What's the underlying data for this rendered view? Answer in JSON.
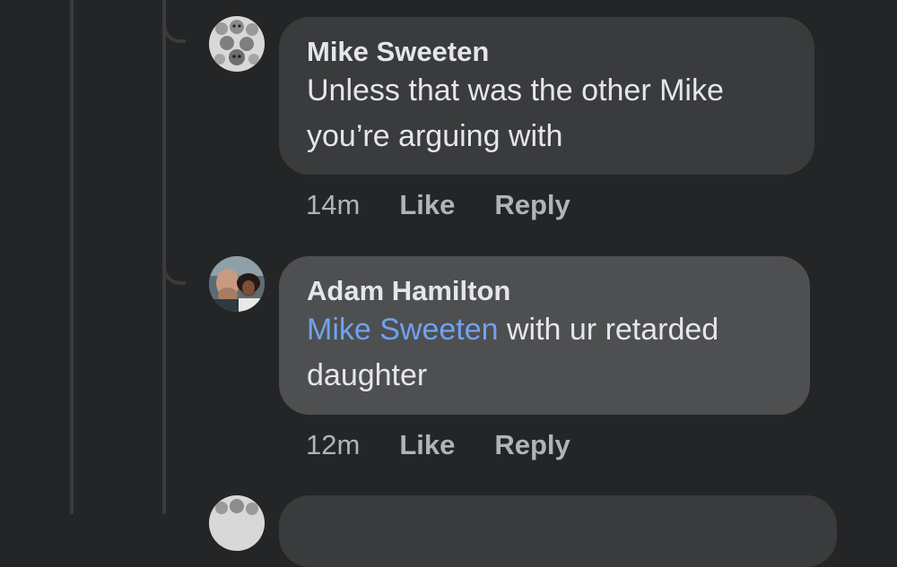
{
  "comments": [
    {
      "author": "Mike Sweeten",
      "text_line1": "Unless that was the other Mike",
      "text_line2": "you’re arguing with",
      "time": "14m",
      "like_label": "Like",
      "reply_label": "Reply"
    },
    {
      "author": "Adam Hamilton",
      "mention": "Mike Sweeten",
      "text_after_mention": " with ur retarded",
      "text_line2": "daughter",
      "time": "12m",
      "like_label": "Like",
      "reply_label": "Reply"
    }
  ],
  "colors": {
    "background": "#242526",
    "bubble": "#3a3b3c",
    "bubble_highlight": "#4e4f50",
    "mention": "#6fa3ef",
    "meta_text": "#b0b3b8"
  },
  "icons": [
    "avatar-mike-sweeten",
    "avatar-adam-hamilton"
  ]
}
